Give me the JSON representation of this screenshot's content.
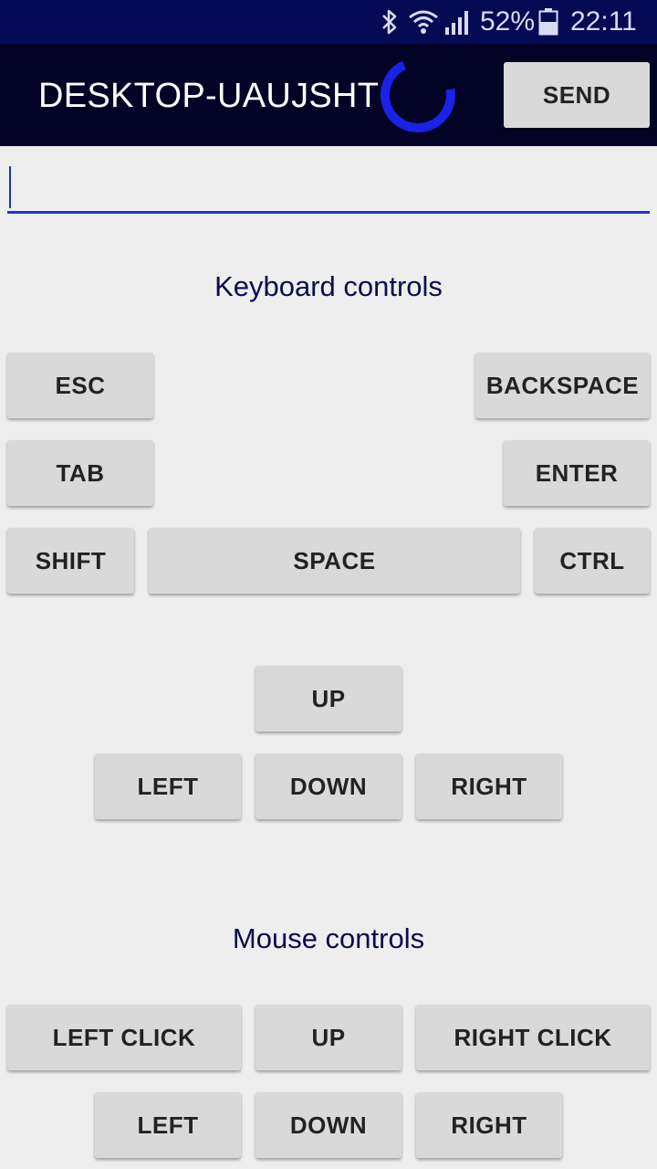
{
  "status_bar": {
    "battery": "52%",
    "time": "22:11",
    "icons": [
      "bluetooth-icon",
      "wifi-icon",
      "signal-icon",
      "battery-icon"
    ]
  },
  "app_bar": {
    "title": "DESKTOP-UAUJSHT",
    "send_label": "SEND",
    "spinner_color": "#1a22e6"
  },
  "input": {
    "value": "",
    "placeholder": ""
  },
  "keyboard": {
    "title": "Keyboard controls",
    "esc": "ESC",
    "backspace": "BACKSPACE",
    "tab": "TAB",
    "enter": "ENTER",
    "shift": "SHIFT",
    "space": "SPACE",
    "ctrl": "CTRL",
    "up": "UP",
    "left": "LEFT",
    "down": "DOWN",
    "right": "RIGHT"
  },
  "mouse": {
    "title": "Mouse controls",
    "left_click": "LEFT CLICK",
    "up": "UP",
    "right_click": "RIGHT CLICK",
    "left": "LEFT",
    "down": "DOWN",
    "right": "RIGHT"
  },
  "colors": {
    "status_bar": "#050a55",
    "app_bar": "#030325",
    "accent": "#2430d0",
    "background": "#eeeeee",
    "button": "#d9d9d9"
  }
}
